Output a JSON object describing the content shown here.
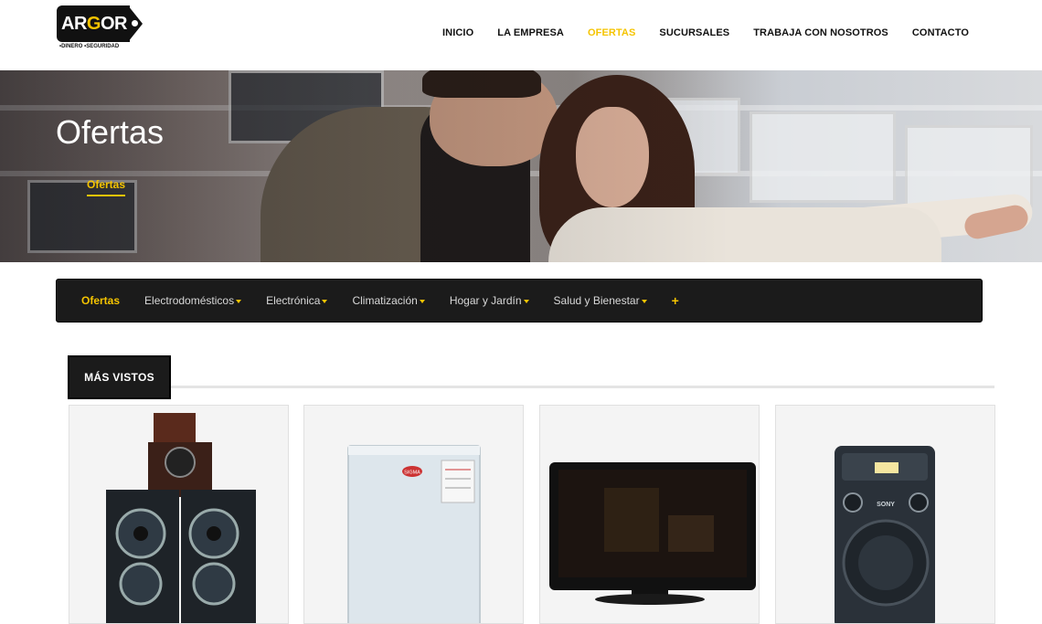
{
  "brand": {
    "logo_text_pre": "AR",
    "logo_text_hl": "G",
    "logo_text_post": "OR",
    "tagline": "•DINERO •SEGURIDAD",
    "accent_color": "#f5c400"
  },
  "nav": {
    "items": [
      {
        "label": "INICIO"
      },
      {
        "label": "LA EMPRESA"
      },
      {
        "label": "OFERTAS",
        "active": true
      },
      {
        "label": "SUCURSALES"
      },
      {
        "label": "TRABAJA CON NOSOTROS"
      },
      {
        "label": "CONTACTO"
      }
    ]
  },
  "hero": {
    "title": "Ofertas",
    "breadcrumb": "Ofertas"
  },
  "categories": {
    "items": [
      {
        "label": "Ofertas",
        "active": true
      },
      {
        "label": "Electrodomésticos",
        "dropdown": true
      },
      {
        "label": "Electrónica",
        "dropdown": true
      },
      {
        "label": "Climatización",
        "dropdown": true
      },
      {
        "label": "Hogar y Jardín",
        "dropdown": true
      },
      {
        "label": "Salud y Bienestar",
        "dropdown": true
      }
    ],
    "more_label": "+"
  },
  "section": {
    "title": "MÁS VISTOS"
  },
  "products": [
    {
      "image": "sound-system-tower-image"
    },
    {
      "image": "mini-fridge-image"
    },
    {
      "image": "lcd-tv-image"
    },
    {
      "image": "party-speaker-image"
    }
  ],
  "product_brands": {
    "speaker_brand": "SONY",
    "fridge_brand": "SIGMA"
  }
}
